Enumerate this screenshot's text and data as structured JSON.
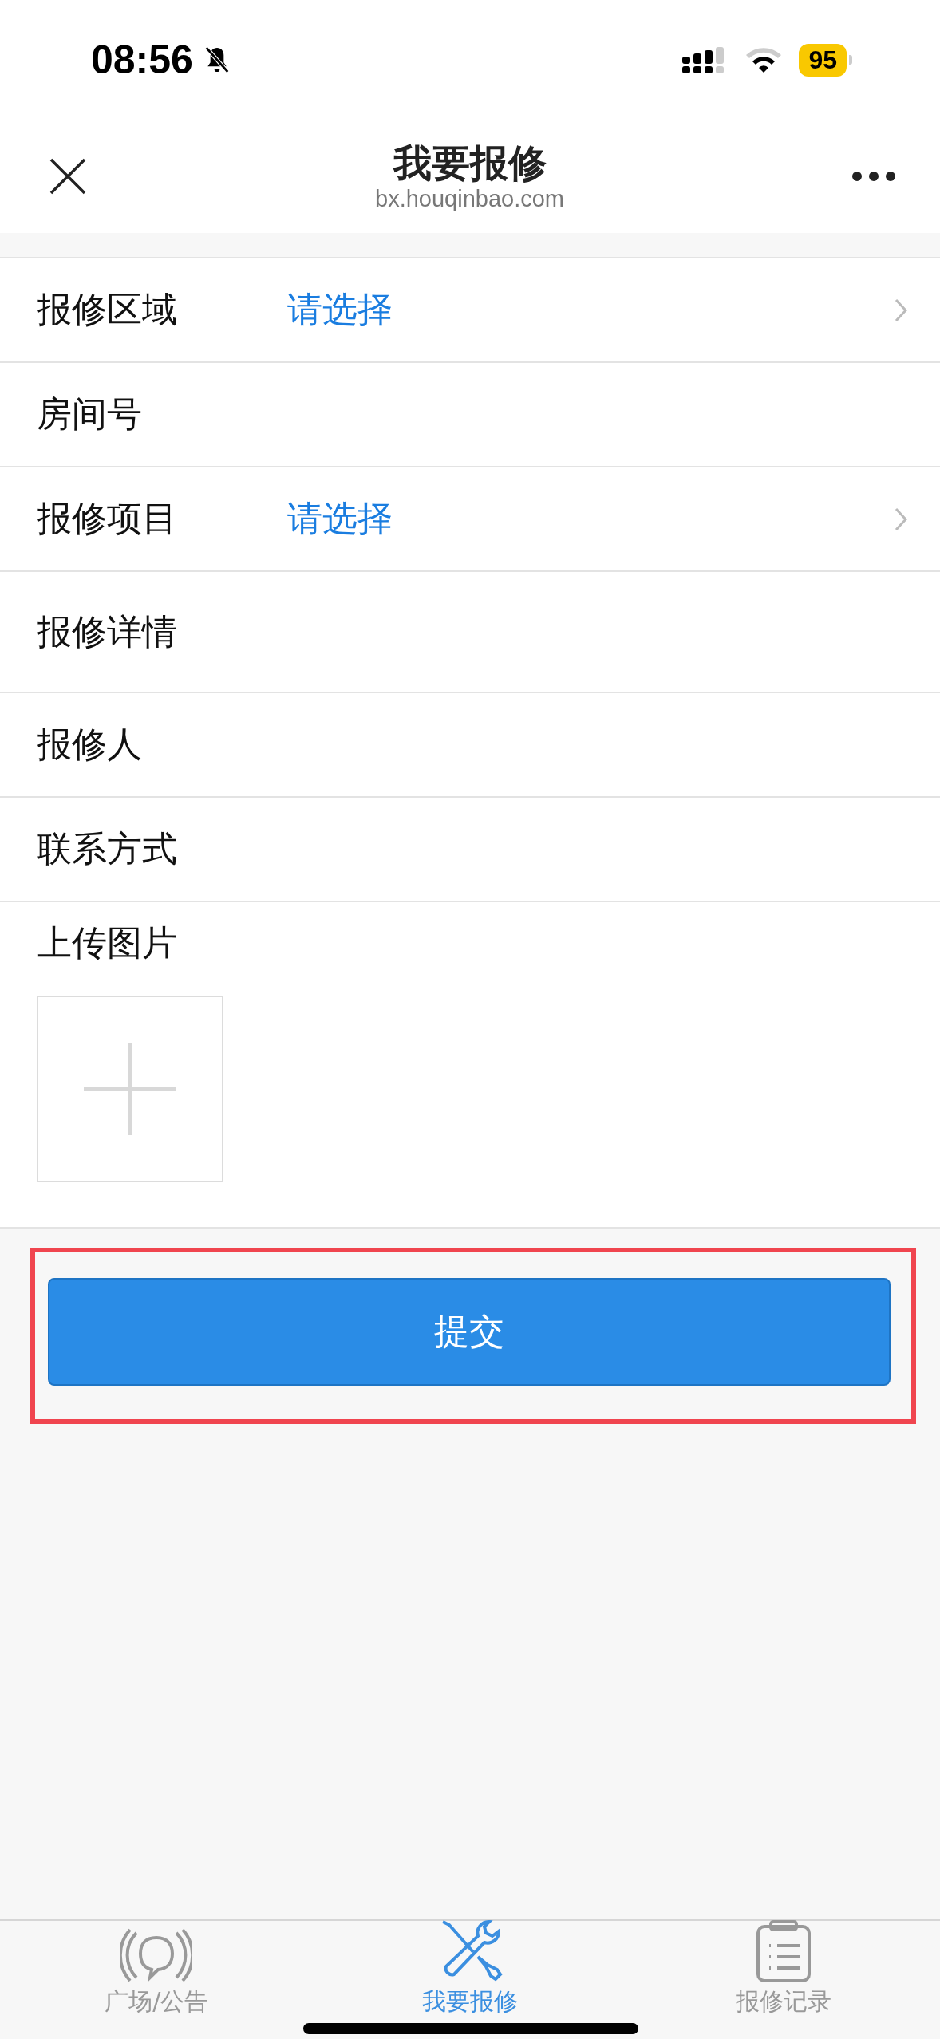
{
  "status_bar": {
    "time": "08:56",
    "battery": "95"
  },
  "header": {
    "title": "我要报修",
    "url": "bx.houqinbao.com"
  },
  "form": {
    "rows": [
      {
        "label": "报修区域",
        "kind": "select",
        "value": "请选择"
      },
      {
        "label": "房间号",
        "kind": "text"
      },
      {
        "label": "报修项目",
        "kind": "select",
        "value": "请选择"
      },
      {
        "label": "报修详情",
        "kind": "textarea"
      },
      {
        "label": "报修人",
        "kind": "text"
      },
      {
        "label": "联系方式",
        "kind": "text"
      }
    ],
    "upload": {
      "label": "上传图片"
    }
  },
  "submit_button": {
    "label": "提交"
  },
  "tabs": [
    {
      "label": "广场/公告",
      "kind": "broadcast",
      "selected": false
    },
    {
      "label": "我要报修",
      "kind": "tools",
      "selected": true
    },
    {
      "label": "报修记录",
      "kind": "clipboard",
      "selected": false
    }
  ]
}
